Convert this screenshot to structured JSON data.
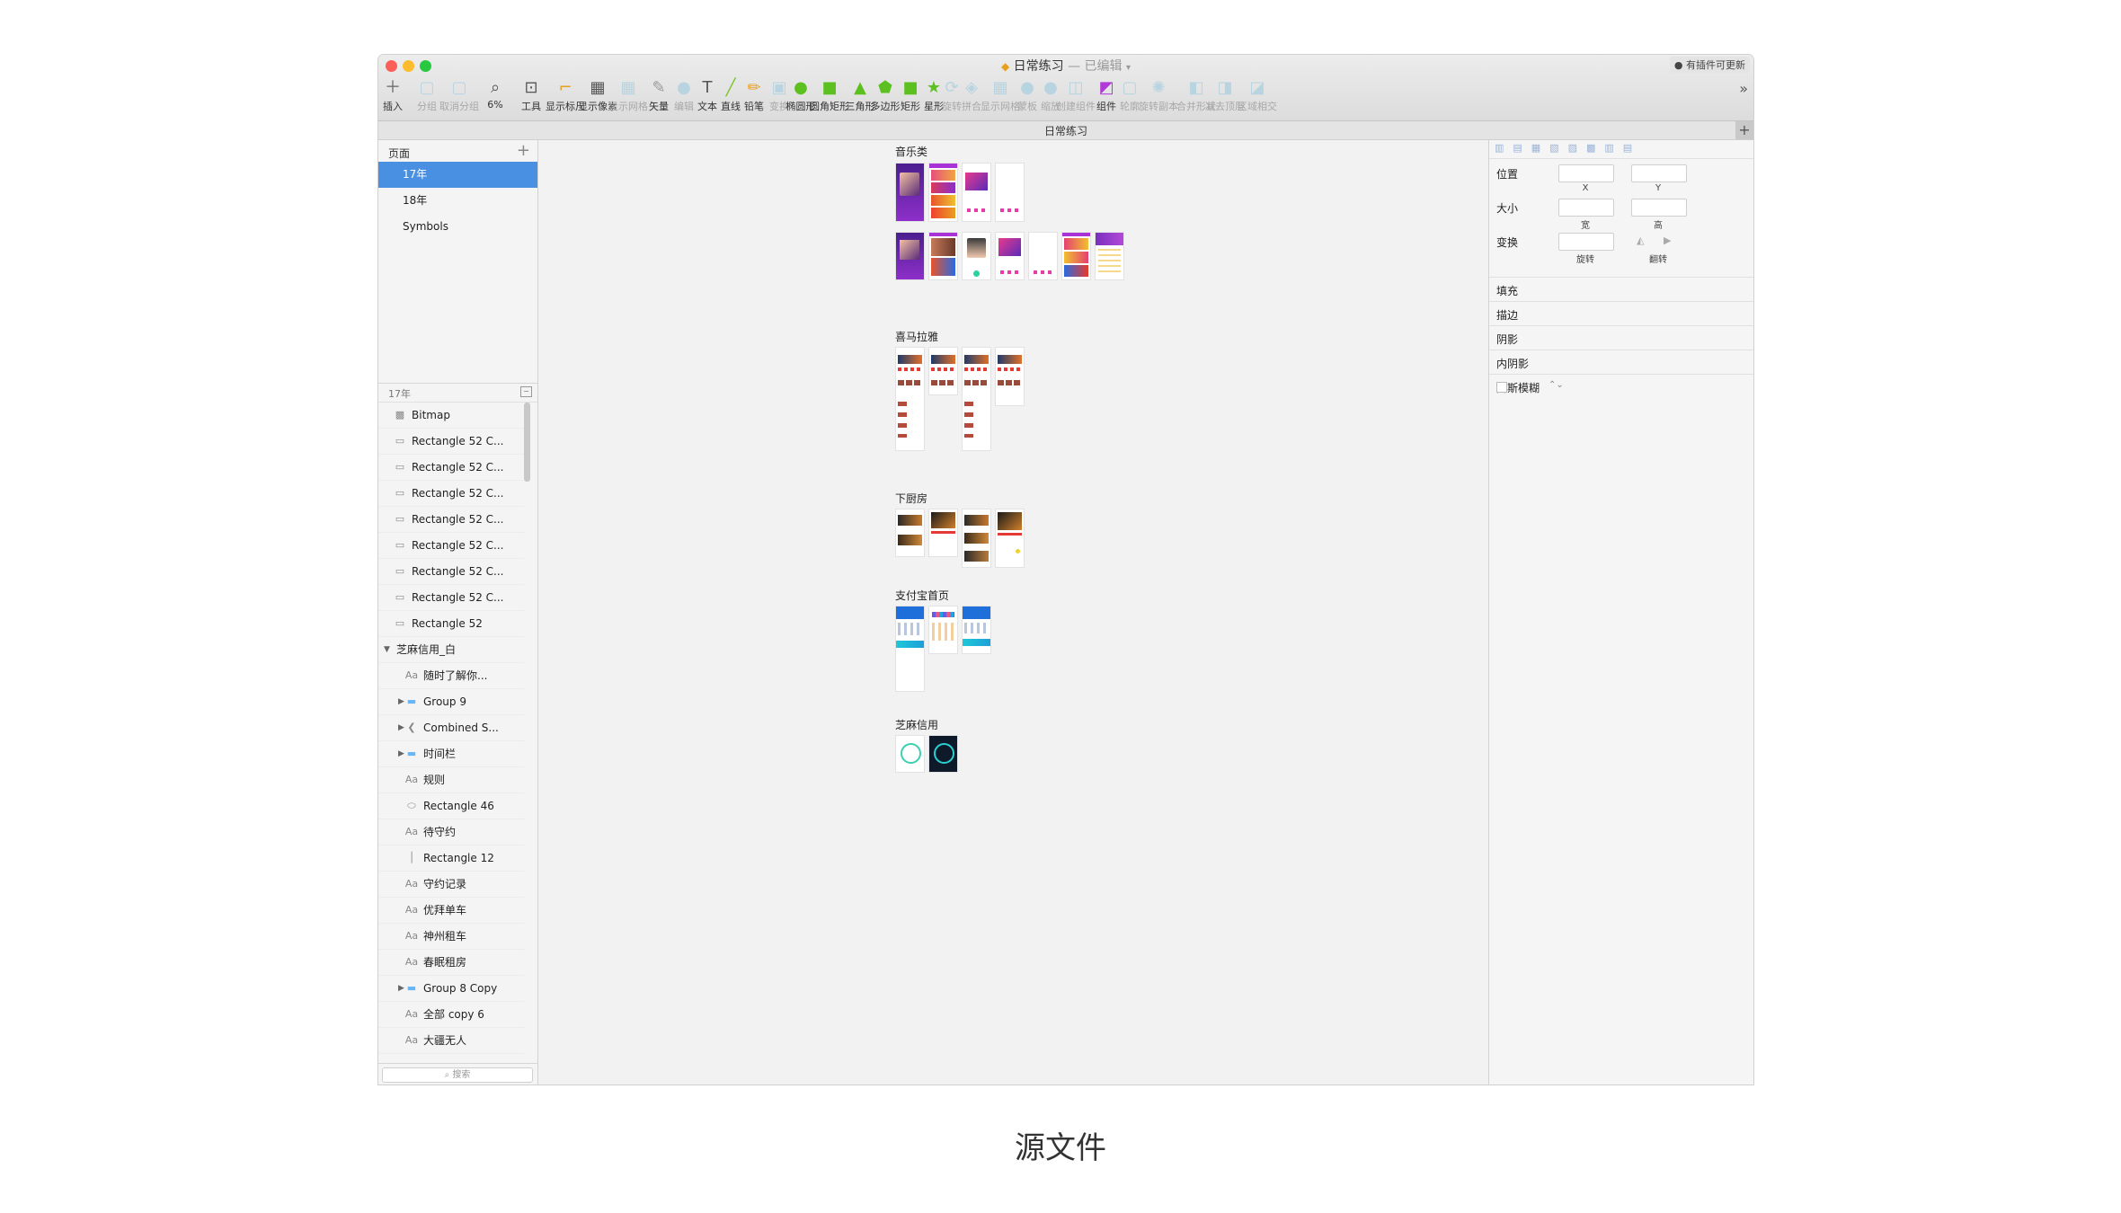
{
  "window": {
    "title": "日常练习",
    "title_status": "— 已编辑",
    "update_badge": "有插件可更新",
    "tab_title": "日常练习"
  },
  "toolbar": {
    "tools": [
      {
        "label": "插入",
        "icon": "plus-icon"
      },
      {
        "label": "分组",
        "icon": "group-icon"
      },
      {
        "label": "取消分组",
        "icon": "ungroup-icon"
      },
      {
        "label": "6%",
        "icon": "zoom-icon"
      },
      {
        "label": "工具",
        "icon": "tools-icon"
      },
      {
        "label": "显示标尺",
        "icon": "ruler-icon"
      },
      {
        "label": "显示像素",
        "icon": "pixel-icon"
      },
      {
        "label": "显示网格",
        "icon": "grid-icon"
      },
      {
        "label": "矢量",
        "icon": "pen-icon"
      },
      {
        "label": "编辑",
        "icon": "edit-icon"
      },
      {
        "label": "文本",
        "icon": "text-icon"
      },
      {
        "label": "直线",
        "icon": "line-icon"
      },
      {
        "label": "铅笔",
        "icon": "pencil-icon"
      },
      {
        "label": "变换",
        "icon": "transform-icon"
      },
      {
        "label": "椭圆形",
        "icon": "oval-icon"
      },
      {
        "label": "圆角矩形",
        "icon": "rounded-rect-icon"
      },
      {
        "label": "三角形",
        "icon": "triangle-icon"
      },
      {
        "label": "多边形",
        "icon": "polygon-icon"
      },
      {
        "label": "矩形",
        "icon": "rectangle-icon"
      },
      {
        "label": "星形",
        "icon": "star-icon"
      },
      {
        "label": "旋转",
        "icon": "rotate-icon"
      },
      {
        "label": "拼合",
        "icon": "flatten-icon"
      },
      {
        "label": "显示网格",
        "icon": "grid2-icon"
      },
      {
        "label": "蒙板",
        "icon": "mask-icon"
      },
      {
        "label": "缩放",
        "icon": "scale-icon"
      },
      {
        "label": "创建组件",
        "icon": "create-symbol-icon"
      },
      {
        "label": "组件",
        "icon": "symbol-icon"
      },
      {
        "label": "轮廓",
        "icon": "outline-icon"
      },
      {
        "label": "旋转副本",
        "icon": "rotate-copies-icon"
      },
      {
        "label": "合并形状",
        "icon": "union-icon"
      },
      {
        "label": "减去顶层",
        "icon": "subtract-icon"
      },
      {
        "label": "区域相交",
        "icon": "intersect-icon"
      }
    ]
  },
  "pages": {
    "header": "页面",
    "items": [
      "17年",
      "18年",
      "Symbols"
    ],
    "selected": "17年"
  },
  "layers": {
    "header": "17年",
    "items": [
      {
        "label": "Bitmap",
        "icon": "bitmap-icon",
        "indent": 0
      },
      {
        "label": "Rectangle 52 C...",
        "icon": "rectangle-icon",
        "indent": 0
      },
      {
        "label": "Rectangle 52 C...",
        "icon": "rectangle-icon",
        "indent": 0
      },
      {
        "label": "Rectangle 52 C...",
        "icon": "rectangle-icon",
        "indent": 0
      },
      {
        "label": "Rectangle 52 C...",
        "icon": "rectangle-icon",
        "indent": 0
      },
      {
        "label": "Rectangle 52 C...",
        "icon": "rectangle-icon",
        "indent": 0
      },
      {
        "label": "Rectangle 52 C...",
        "icon": "rectangle-icon",
        "indent": 0
      },
      {
        "label": "Rectangle 52 C...",
        "icon": "rectangle-icon",
        "indent": 0
      },
      {
        "label": "Rectangle 52",
        "icon": "rectangle-icon",
        "indent": 0
      },
      {
        "label": "芝麻信用_白",
        "icon": "artboard-icon",
        "indent": -1
      },
      {
        "label": "随时了解你...",
        "icon": "text-icon",
        "indent": 1
      },
      {
        "label": "Group 9",
        "icon": "folder-icon",
        "indent": 1
      },
      {
        "label": "Combined S...",
        "icon": "combined-shape-icon",
        "indent": 1
      },
      {
        "label": "时间栏",
        "icon": "folder-icon",
        "indent": 1
      },
      {
        "label": "规则",
        "icon": "text-icon",
        "indent": 1
      },
      {
        "label": "Rectangle 46",
        "icon": "rounded-rect-icon",
        "indent": 1
      },
      {
        "label": "待守约",
        "icon": "text-icon",
        "indent": 1
      },
      {
        "label": "Rectangle 12",
        "icon": "line-icon",
        "indent": 1
      },
      {
        "label": "守约记录",
        "icon": "text-icon",
        "indent": 1
      },
      {
        "label": "优拜单车",
        "icon": "text-icon",
        "indent": 1
      },
      {
        "label": "神州租车",
        "icon": "text-icon",
        "indent": 1
      },
      {
        "label": "春眠租房",
        "icon": "text-icon",
        "indent": 1
      },
      {
        "label": "Group 8 Copy",
        "icon": "folder-icon",
        "indent": 1
      },
      {
        "label": "全部 copy 6",
        "icon": "text-icon",
        "indent": 1
      },
      {
        "label": "大疆无人",
        "icon": "text-icon",
        "indent": 1
      }
    ],
    "search_placeholder": "搜索"
  },
  "canvas": {
    "sections": [
      "音乐类",
      "喜马拉雅",
      "下厨房",
      "支付宝首页",
      "芝麻信用"
    ]
  },
  "inspector": {
    "position_label": "位置",
    "size_label": "大小",
    "transform_label": "变换",
    "x_label": "X",
    "y_label": "Y",
    "w_label": "宽",
    "h_label": "高",
    "rotate_label": "旋转",
    "flip_label": "翻转",
    "sections": [
      "填充",
      "描边",
      "阴影",
      "内阴影",
      "高斯模糊"
    ]
  },
  "caption": "源文件",
  "colors": {
    "selection": "#4a90e2",
    "music_purple": "#7b2fbe",
    "music_pink": "#e91e8c",
    "ximalaya_red": "#e53935",
    "alipay_blue": "#1e6fd9"
  }
}
